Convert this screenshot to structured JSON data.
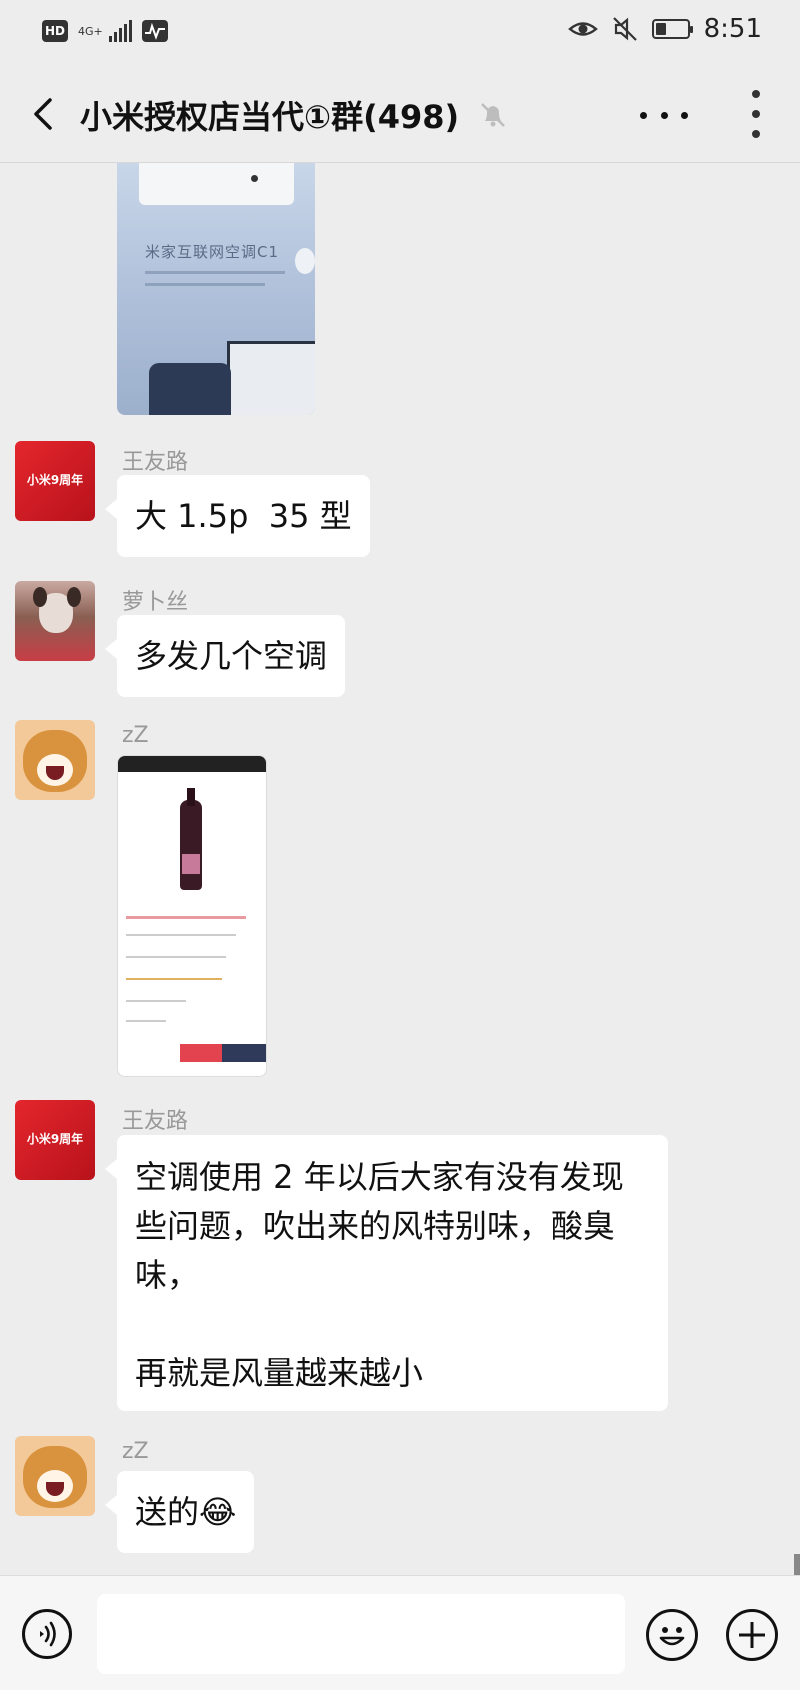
{
  "status_bar": {
    "time": "8:51",
    "hd_label": "HD",
    "network_label": "4G+",
    "battery_level": 0.35
  },
  "header": {
    "title": "小米授权店当代①群(498)"
  },
  "icons": {
    "back": "chevron-left-icon",
    "mute": "bell-off-icon",
    "more_horizontal": "more-horizontal-icon",
    "more_vertical": "more-vertical-icon",
    "voice": "voice-icon",
    "emoji": "emoji-icon",
    "plus": "plus-icon"
  },
  "messages": [
    {
      "type": "image",
      "description": "air-conditioner-ad",
      "image_text": "米家互联网空调C1"
    },
    {
      "type": "text",
      "sender": "王友路",
      "text": "大 1.5p  35 型"
    },
    {
      "type": "text",
      "sender": "萝卜丝",
      "text": "多发几个空调"
    },
    {
      "type": "image",
      "sender": "zZ",
      "description": "wine-product-screenshot"
    },
    {
      "type": "text",
      "sender": "王友路",
      "text": "空调使用 2 年以后大家有没有发现\n些问题，吹出来的风特别味，酸臭\n味，\n\n再就是风量越来越小"
    },
    {
      "type": "text",
      "sender": "zZ",
      "text": "送的😂"
    }
  ],
  "avatar_badge_text": "小米9周年",
  "colors": {
    "background": "#ededed",
    "bubble": "#ffffff",
    "sender_name": "#999999",
    "avatar_red": "#d41a2b"
  }
}
